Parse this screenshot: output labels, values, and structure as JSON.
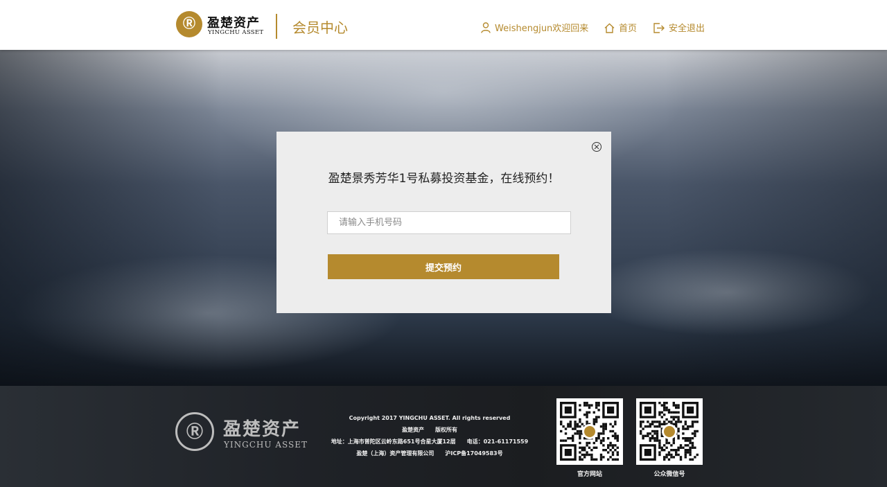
{
  "header": {
    "logo_cn": "盈楚资产",
    "logo_en": "YINGCHU ASSET",
    "section_title": "会员中心",
    "nav": {
      "welcome": "Weishengjun欢迎回来",
      "home": "首页",
      "logout": "安全退出"
    }
  },
  "modal": {
    "title": "盈楚景秀芳华1号私募投资基金，在线预约！",
    "phone_input": {
      "placeholder": "请输入手机号码",
      "value": ""
    },
    "submit_label": "提交预约"
  },
  "footer": {
    "logo_cn": "盈楚资产",
    "logo_en": "YINGCHU ASSET",
    "copyright": "Copyright 2017 YINGCHU ASSET. All rights reserved",
    "rights": "盈楚资产　　版权所有",
    "address": "地址：上海市普陀区云岭东路651号合星大厦12层　　电话：021-61171559",
    "company_icp": "盈楚（上海）资产管理有限公司　　沪ICP备17049583号",
    "qr_codes": [
      {
        "label": "官方网站"
      },
      {
        "label": "公众微信号"
      }
    ]
  },
  "colors": {
    "accent": "#b58a2e",
    "modal_bg": "#ededed",
    "footer_bg": "#1f2227"
  },
  "icons": [
    "user-icon",
    "home-icon",
    "logout-icon",
    "close-icon"
  ]
}
